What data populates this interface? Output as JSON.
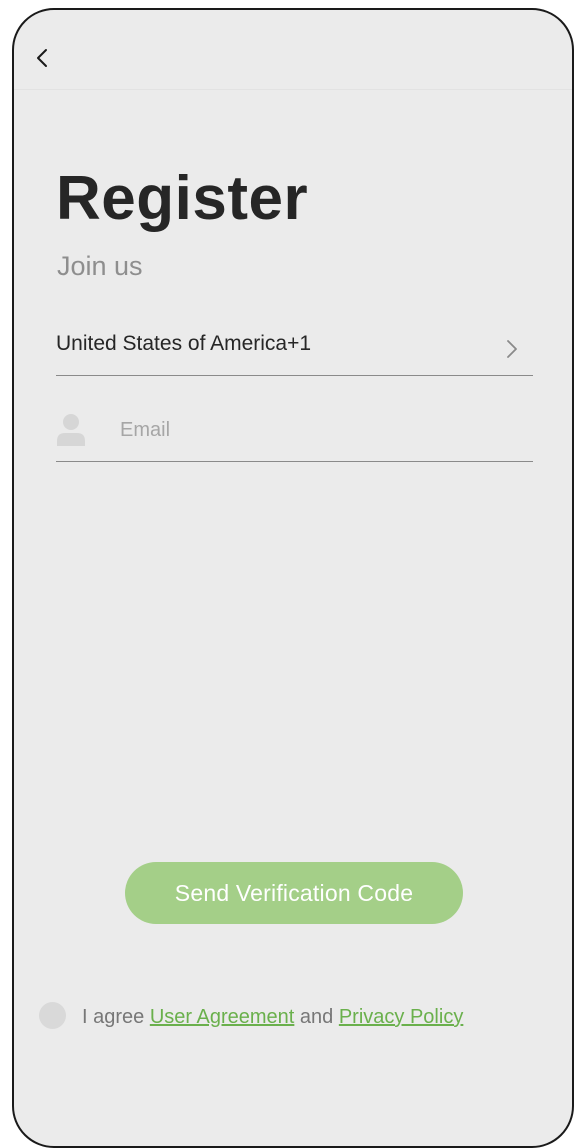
{
  "header": {
    "back_icon": "chevron-left-icon"
  },
  "register": {
    "title": "Register",
    "subtitle": "Join us"
  },
  "country": {
    "label": "United States of America+1",
    "icon": "chevron-right-icon"
  },
  "email": {
    "icon": "user-icon",
    "value": "",
    "placeholder": "Email"
  },
  "actions": {
    "send_label": "Send Verification Code"
  },
  "agreement": {
    "prefix": "I agree",
    "user_agreement": "User Agreement",
    "conjunction": "and",
    "privacy_policy": "Privacy Policy",
    "checked": false
  },
  "colors": {
    "background": "#ebebeb",
    "accent": "#a4cf88",
    "link": "#6ab04c",
    "title": "#262626",
    "muted": "#8e8e8e"
  }
}
